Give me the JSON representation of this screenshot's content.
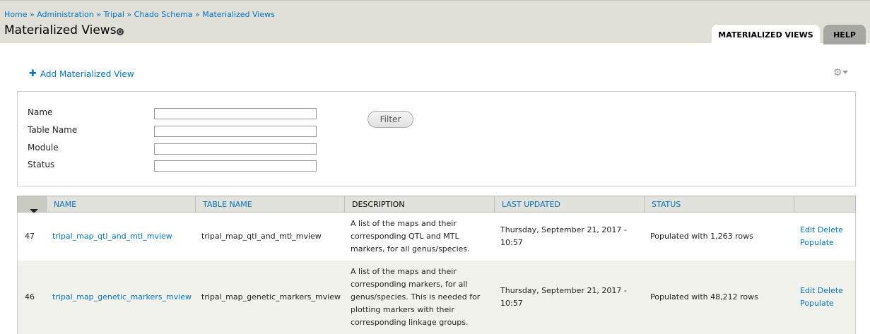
{
  "breadcrumb": {
    "items": [
      "Home",
      "Administration",
      "Tripal",
      "Chado Schema",
      "Materialized Views"
    ],
    "separator": "»"
  },
  "page_title": "Materialized Views",
  "tabs": [
    {
      "label": "MATERIALIZED VIEWS",
      "active": true
    },
    {
      "label": "HELP",
      "active": false
    }
  ],
  "actions": {
    "add_label": "Add Materialized View",
    "add_icon": "plus-icon"
  },
  "filter": {
    "fields": [
      {
        "label": "Name",
        "value": ""
      },
      {
        "label": "Table Name",
        "value": ""
      },
      {
        "label": "Module",
        "value": ""
      },
      {
        "label": "Status",
        "value": ""
      }
    ],
    "button_label": "Filter"
  },
  "table": {
    "headers": [
      "NAME",
      "TABLE NAME",
      "DESCRIPTION",
      "LAST UPDATED",
      "STATUS"
    ],
    "rows": [
      {
        "id": "47",
        "name": "tripal_map_qtl_and_mtl_mview",
        "table_name": "tripal_map_qtl_and_mtl_mview",
        "description_lines": [
          "A list of the maps and their",
          "corresponding QTL and MTL",
          "markers, for all genus/species."
        ],
        "last_updated_lines": [
          "Thursday, September 21, 2017 -",
          "10:57"
        ],
        "status": "Populated with 1,263 rows",
        "edit": "Edit",
        "delete": "Delete",
        "populate": "Populate"
      },
      {
        "id": "46",
        "name": "tripal_map_genetic_markers_mview",
        "table_name": "tripal_map_genetic_markers_mview",
        "description_lines": [
          "A list of the maps and their",
          "corresponding markers, for all",
          "genus/species. This is needed for",
          "plotting markers with their",
          "corresponding linkage groups."
        ],
        "last_updated_lines": [
          "Thursday, September 21, 2017 -",
          "10:57"
        ],
        "status": "Populated with 48,212 rows",
        "edit": "Edit",
        "delete": "Delete",
        "populate": "Populate"
      }
    ]
  },
  "colors": {
    "link": "#0074bd",
    "header_bg": "#e0e0d8",
    "row_alt": "#f2f2ed"
  }
}
